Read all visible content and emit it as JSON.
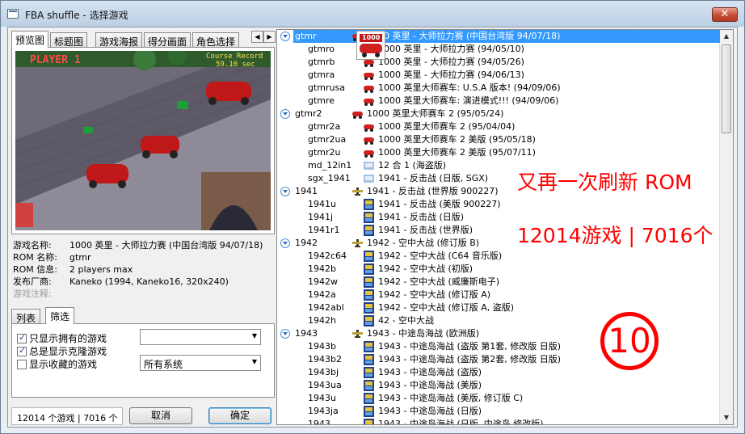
{
  "window": {
    "title": "FBA shuffle - 选择游戏",
    "close_glyph": "✕"
  },
  "left": {
    "tabs": [
      "预览图",
      "标题图",
      "游戏海报",
      "得分画面",
      "角色选择"
    ],
    "tab_scroll": {
      "left": "◀",
      "right": "▶"
    },
    "preview": {
      "player_text": "PLAYER 1",
      "course_text": "Course Record",
      "time_text": "59.10 sec"
    },
    "info": {
      "name_label": "游戏名称:",
      "name_value": "1000 英里 - 大师拉力赛 (中国台湾版 94/07/18)",
      "rom_label": "ROM 名称:",
      "rom_value": "gtmr",
      "rominfo_label": "ROM 信息:",
      "rominfo_value": "2 players max",
      "maker_label": "发布厂商:",
      "maker_value": "Kaneko (1994, Kaneko16, 320x240)",
      "notes_label": "游戏注释:"
    },
    "filter_tabs": [
      "列表",
      "筛选"
    ],
    "filters": {
      "only_owned": "只显示拥有的游戏",
      "show_clones": "总是显示克隆游戏",
      "show_favorites": "显示收藏的游戏",
      "combo1_value": "",
      "combo2_value": "所有系统"
    },
    "status": "12014 个游戏 | 7016 个",
    "cancel_label": "取消",
    "ok_label": "确定"
  },
  "tree": {
    "rows": [
      {
        "id": "gtmr",
        "title": "1000 英里 - 大师拉力赛 (中国台湾版 94/07/18)",
        "parent": true,
        "selected": true,
        "icon": "race-car-icon",
        "color": "#d02020"
      },
      {
        "id": "gtmro",
        "title": "1000 英里 - 大师拉力赛 (94/05/10)",
        "parent": false,
        "icon": "race-car-icon",
        "color": "#d02020"
      },
      {
        "id": "gtmrb",
        "title": "1000 英里 - 大师拉力赛 (94/05/26)",
        "parent": false,
        "icon": "race-car-icon",
        "color": "#d02020"
      },
      {
        "id": "gtmra",
        "title": "1000 英里 - 大师拉力赛 (94/06/13)",
        "parent": false,
        "icon": "race-car-icon",
        "color": "#d02020"
      },
      {
        "id": "gtmrusa",
        "title": "1000 英里大师赛车: U.S.A 版本! (94/09/06)",
        "parent": false,
        "icon": "race-car-icon",
        "color": "#d02020"
      },
      {
        "id": "gtmre",
        "title": "1000 英里大师赛车: 演进模式!!! (94/09/06)",
        "parent": false,
        "icon": "race-car-icon",
        "color": "#d02020"
      },
      {
        "id": "gtmr2",
        "title": "1000 英里大师赛车 2 (95/05/24)",
        "parent": true,
        "icon": "race-car-icon",
        "color": "#d02020"
      },
      {
        "id": "gtmr2a",
        "title": "1000 英里大师赛车 2 (95/04/04)",
        "parent": false,
        "icon": "race-car-icon",
        "color": "#d02020"
      },
      {
        "id": "gtmr2ua",
        "title": "1000 英里大师赛车 2 美版 (95/05/18)",
        "parent": false,
        "icon": "race-car-icon",
        "color": "#d02020"
      },
      {
        "id": "gtmr2u",
        "title": "1000 英里大师赛车 2 美版 (95/07/11)",
        "parent": false,
        "icon": "race-car-icon",
        "color": "#d02020"
      },
      {
        "id": "md_12in1",
        "title": "12 合 1 (海盗版)",
        "parent": false,
        "icon": "cartridge-icon",
        "color": "#5b8fcf"
      },
      {
        "id": "sgx_1941",
        "title": "1941 - 反击战 (日版, SGX)",
        "parent": false,
        "icon": "cartridge-icon",
        "color": "#5b8fcf"
      },
      {
        "id": "1941",
        "title": "1941 - 反击战 (世界版 900227)",
        "parent": true,
        "icon": "plane-icon",
        "color": "#3c3c1e"
      },
      {
        "id": "1941u",
        "title": "1941 - 反击战 (美版 900227)",
        "parent": false,
        "icon": "poster-icon",
        "color": "#1f3f8a"
      },
      {
        "id": "1941j",
        "title": "1941 - 反击战 (日版)",
        "parent": false,
        "icon": "poster-icon",
        "color": "#1f3f8a"
      },
      {
        "id": "1941r1",
        "title": "1941 - 反击战 (世界版)",
        "parent": false,
        "icon": "poster-icon",
        "color": "#1f3f8a"
      },
      {
        "id": "1942",
        "title": "1942 - 空中大战 (修订版 B)",
        "parent": true,
        "icon": "plane-icon",
        "color": "#3c3c1e"
      },
      {
        "id": "1942c64",
        "title": "1942 - 空中大战 (C64 音乐版)",
        "parent": false,
        "icon": "poster-icon",
        "color": "#1f3f8a"
      },
      {
        "id": "1942b",
        "title": "1942 - 空中大战 (初版)",
        "parent": false,
        "icon": "poster-icon",
        "color": "#1f3f8a"
      },
      {
        "id": "1942w",
        "title": "1942 - 空中大战 (威廉斯电子)",
        "parent": false,
        "icon": "poster-icon",
        "color": "#1f3f8a"
      },
      {
        "id": "1942a",
        "title": "1942 - 空中大战 (修订版 A)",
        "parent": false,
        "icon": "poster-icon",
        "color": "#1f3f8a"
      },
      {
        "id": "1942abl",
        "title": "1942 - 空中大战 (修订版 A, 盗版)",
        "parent": false,
        "icon": "poster-icon",
        "color": "#1f3f8a"
      },
      {
        "id": "1942h",
        "title": "42 - 空中大战",
        "parent": false,
        "icon": "poster-icon",
        "color": "#1f3f8a"
      },
      {
        "id": "1943",
        "title": "1943 - 中途岛海战 (欧洲版)",
        "parent": true,
        "icon": "plane-icon",
        "color": "#3c3c1e"
      },
      {
        "id": "1943b",
        "title": "1943 - 中途岛海战 (盗版 第1套, 修改版 日版)",
        "parent": false,
        "icon": "poster-icon",
        "color": "#1f3f8a"
      },
      {
        "id": "1943b2",
        "title": "1943 - 中途岛海战 (盗版 第2套, 修改版 日版)",
        "parent": false,
        "icon": "poster-icon",
        "color": "#1f3f8a"
      },
      {
        "id": "1943bj",
        "title": "1943 - 中途岛海战 (盗版)",
        "parent": false,
        "icon": "poster-icon",
        "color": "#1f3f8a"
      },
      {
        "id": "1943ua",
        "title": "1943 - 中途岛海战 (美版)",
        "parent": false,
        "icon": "poster-icon",
        "color": "#1f3f8a"
      },
      {
        "id": "1943u",
        "title": "1943 - 中途岛海战 (美版, 修订版 C)",
        "parent": false,
        "icon": "poster-icon",
        "color": "#1f3f8a"
      },
      {
        "id": "1943ja",
        "title": "1943 - 中途岛海战 (日版)",
        "parent": false,
        "icon": "poster-icon",
        "color": "#1f3f8a"
      },
      {
        "id": "1943...",
        "title": "1943 - 中途岛海战 (日版, 中途岛 修改版)",
        "parent": false,
        "icon": "poster-icon",
        "color": "#1f3f8a"
      }
    ],
    "big_icon_label": "1000"
  },
  "overlay": {
    "line1": "又再一次刷新 ROM",
    "line2": "12014游戏 | 7016个",
    "circled_number": "10"
  },
  "colors": {
    "selection": "#3399ff",
    "overlay_red": "#ff0000"
  }
}
